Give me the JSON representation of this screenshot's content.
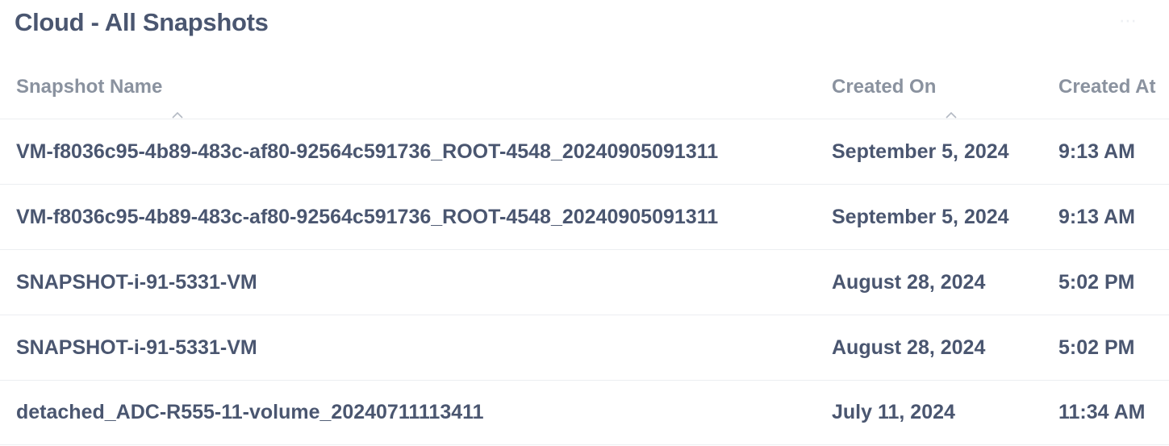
{
  "panel": {
    "title": "Cloud - All Snapshots",
    "more_icon": "ellipsis-icon"
  },
  "table": {
    "columns": [
      {
        "label": "Snapshot Name",
        "sort_icon": "sort-asc-icon"
      },
      {
        "label": "Created On",
        "sort_icon": "sort-asc-icon"
      },
      {
        "label": "Created At"
      }
    ],
    "rows": [
      {
        "name": "VM-f8036c95-4b89-483c-af80-92564c591736_ROOT-4548_20240905091311",
        "created_on": "September 5, 2024",
        "created_at": "9:13 AM"
      },
      {
        "name": "VM-f8036c95-4b89-483c-af80-92564c591736_ROOT-4548_20240905091311",
        "created_on": "September 5, 2024",
        "created_at": "9:13 AM"
      },
      {
        "name": "SNAPSHOT-i-91-5331-VM",
        "created_on": "August 28, 2024",
        "created_at": "5:02 PM"
      },
      {
        "name": "SNAPSHOT-i-91-5331-VM",
        "created_on": "August 28, 2024",
        "created_at": "5:02 PM"
      },
      {
        "name": "detached_ADC-R555-11-volume_20240711113411",
        "created_on": "July 11, 2024",
        "created_at": "11:34 AM"
      }
    ]
  },
  "colors": {
    "text_primary": "#4a5670",
    "text_header": "#8a929f",
    "divider": "#eceef1"
  }
}
